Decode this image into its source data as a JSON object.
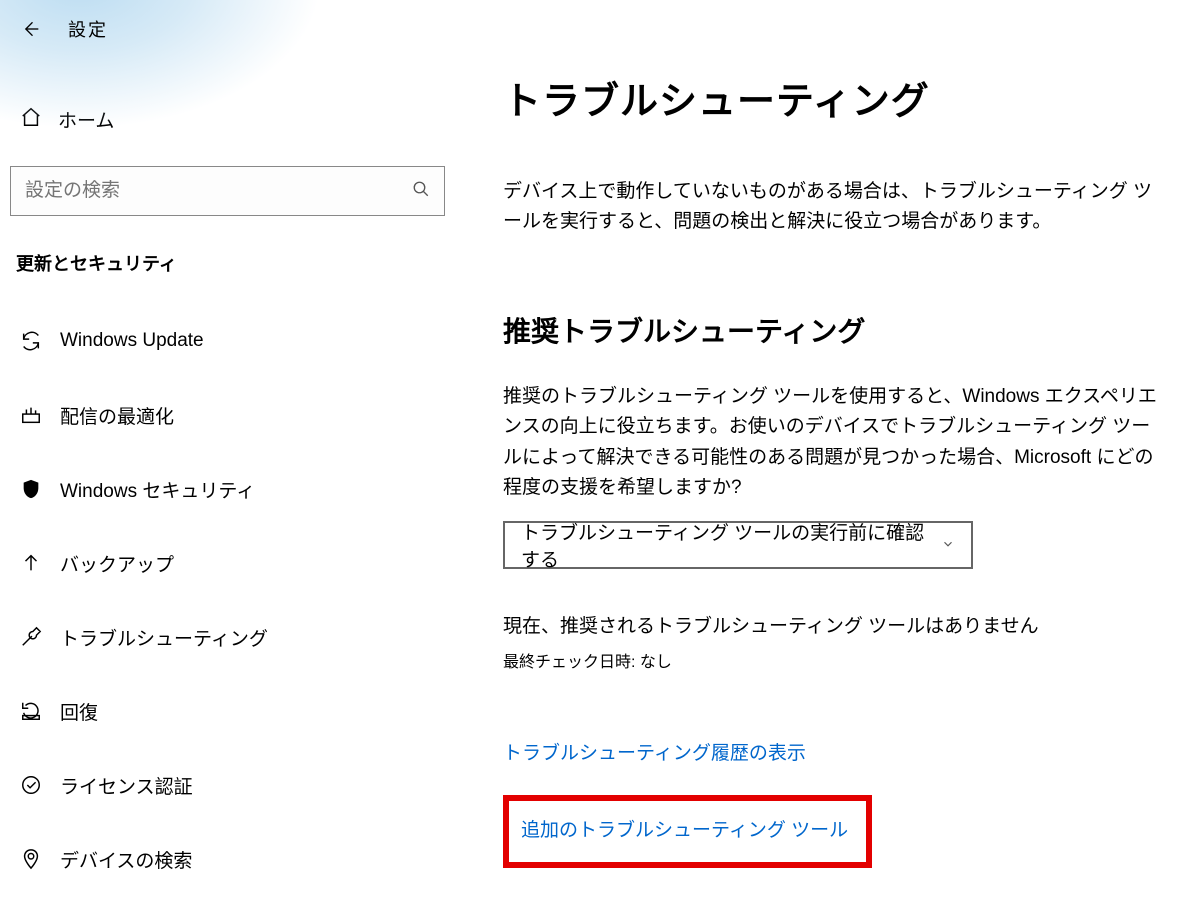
{
  "header": {
    "title": "設定"
  },
  "sidebar": {
    "home_label": "ホーム",
    "search_placeholder": "設定の検索",
    "section_label": "更新とセキュリティ",
    "items": [
      {
        "id": "windows-update",
        "label": "Windows Update"
      },
      {
        "id": "delivery-optimization",
        "label": "配信の最適化"
      },
      {
        "id": "windows-security",
        "label": "Windows セキュリティ"
      },
      {
        "id": "backup",
        "label": "バックアップ"
      },
      {
        "id": "troubleshoot",
        "label": "トラブルシューティング"
      },
      {
        "id": "recovery",
        "label": "回復"
      },
      {
        "id": "activation",
        "label": "ライセンス認証"
      },
      {
        "id": "find-my-device",
        "label": "デバイスの検索"
      }
    ]
  },
  "main": {
    "title": "トラブルシューティング",
    "description": "デバイス上で動作していないものがある場合は、トラブルシューティング ツールを実行すると、問題の検出と解決に役立つ場合があります。",
    "subheading": "推奨トラブルシューティング",
    "description2": "推奨のトラブルシューティング ツールを使用すると、Windows エクスペリエンスの向上に役立ちます。お使いのデバイスでトラブルシューティング ツールによって解決できる可能性のある問題が見つかった場合、Microsoft にどの程度の支援を希望しますか?",
    "dropdown_selected": "トラブルシューティング ツールの実行前に確認する",
    "status_line": "現在、推奨されるトラブルシューティング ツールはありません",
    "last_checked": "最終チェック日時: なし",
    "link_history": "トラブルシューティング履歴の表示",
    "link_additional": "追加のトラブルシューティング ツール"
  }
}
